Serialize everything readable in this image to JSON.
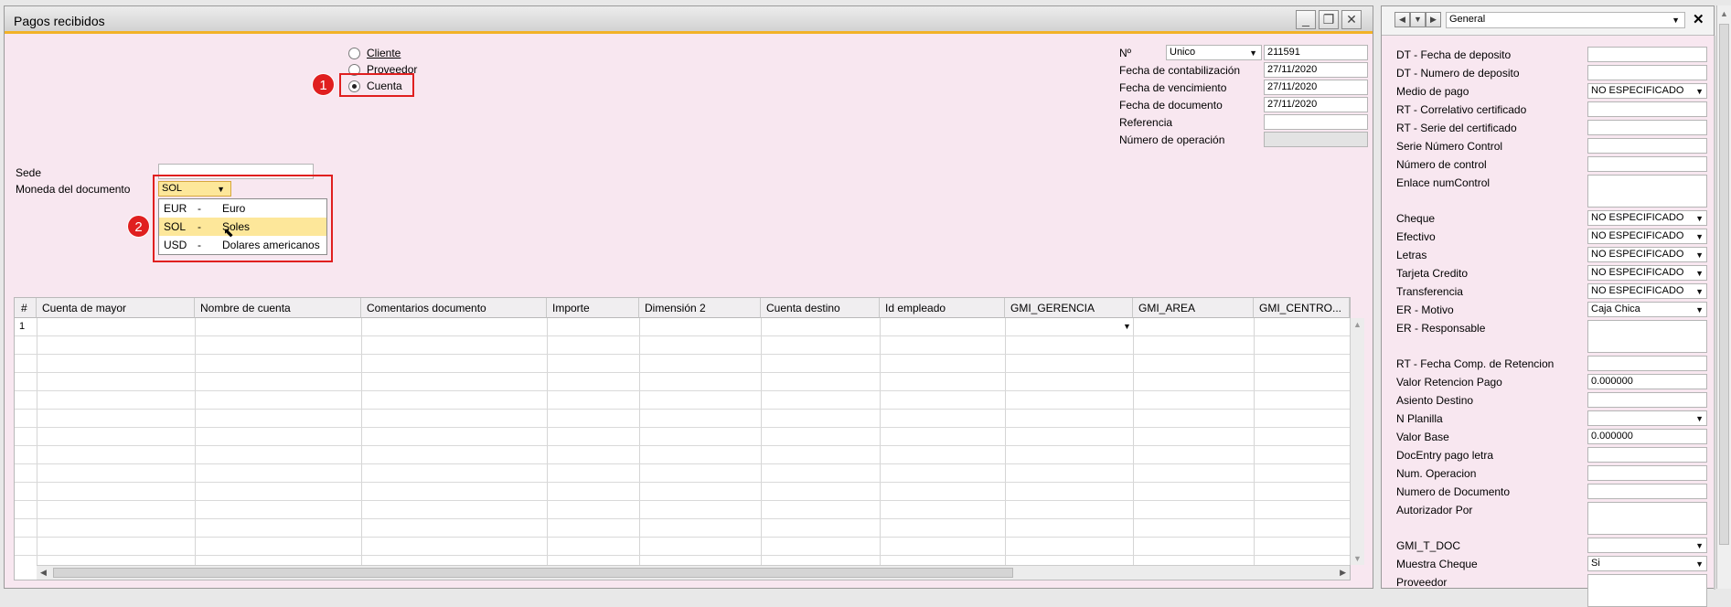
{
  "window": {
    "title": "Pagos recibidos",
    "minimize": "_",
    "restore": "❐",
    "close": "✕"
  },
  "radio": {
    "cliente": "Cliente",
    "proveedor": "Proveedor",
    "cuenta": "Cuenta",
    "selected": "Cuenta"
  },
  "markers": {
    "one": "1",
    "two": "2"
  },
  "header_fields": {
    "no_label": "Nº",
    "no_series": "Unico",
    "no_value": "211591",
    "fecha_contab_label": "Fecha de contabilización",
    "fecha_contab": "27/11/2020",
    "fecha_venc_label": "Fecha de vencimiento",
    "fecha_venc": "27/11/2020",
    "fecha_doc_label": "Fecha de documento",
    "fecha_doc": "27/11/2020",
    "referencia_label": "Referencia",
    "referencia": "",
    "num_operacion_label": "Número de operación",
    "num_operacion": ""
  },
  "sede": {
    "label": "Sede",
    "value": ""
  },
  "moneda": {
    "label": "Moneda del documento",
    "value": "SOL",
    "options": [
      {
        "code": "EUR",
        "sep": "-",
        "name": "Euro"
      },
      {
        "code": "SOL",
        "sep": "-",
        "name": "Soles"
      },
      {
        "code": "USD",
        "sep": "-",
        "name": "Dolares americanos"
      }
    ],
    "highlighted": "SOL"
  },
  "grid": {
    "columns": [
      "#",
      "Cuenta de mayor",
      "Nombre de cuenta",
      "Comentarios documento",
      "Importe",
      "Dimensión 2",
      "Cuenta destino",
      "Id empleado",
      "GMI_GERENCIA",
      "GMI_AREA",
      "GMI_CENTRO..."
    ],
    "first_row_num": "1"
  },
  "side_panel": {
    "nav_prev": "◀",
    "nav_down": "▼",
    "nav_next": "▶",
    "category": "General",
    "close": "✕",
    "fields": [
      {
        "label": "DT - Fecha de deposito",
        "value": ""
      },
      {
        "label": "DT - Numero de deposito",
        "value": ""
      },
      {
        "label": "Medio de pago",
        "value": "NO ESPECIFICADO",
        "dropdown": true
      },
      {
        "label": "RT - Correlativo certificado",
        "value": ""
      },
      {
        "label": "RT - Serie del certificado",
        "value": ""
      },
      {
        "label": "Serie Número Control",
        "value": ""
      },
      {
        "label": "Número de control",
        "value": ""
      },
      {
        "label": "Enlace numControl",
        "value": "",
        "tall": true
      },
      {
        "label": "Cheque",
        "value": "NO ESPECIFICADO",
        "dropdown": true
      },
      {
        "label": "Efectivo",
        "value": "NO ESPECIFICADO",
        "dropdown": true
      },
      {
        "label": "Letras",
        "value": "NO ESPECIFICADO",
        "dropdown": true
      },
      {
        "label": "Tarjeta Credito",
        "value": "NO ESPECIFICADO",
        "dropdown": true
      },
      {
        "label": "Transferencia",
        "value": "NO ESPECIFICADO",
        "dropdown": true
      },
      {
        "label": "ER - Motivo",
        "value": "Caja Chica",
        "dropdown": true
      },
      {
        "label": "ER - Responsable",
        "value": "",
        "tall": true
      },
      {
        "label": "RT - Fecha Comp. de Retencion",
        "value": ""
      },
      {
        "label": "Valor Retencion Pago",
        "value": "0.000000"
      },
      {
        "label": "Asiento Destino",
        "value": ""
      },
      {
        "label": "N Planilla",
        "value": "",
        "dropdown": true
      },
      {
        "label": "Valor Base",
        "value": "0.000000"
      },
      {
        "label": "DocEntry pago letra",
        "value": ""
      },
      {
        "label": "Num. Operacion",
        "value": ""
      },
      {
        "label": "Numero de Documento",
        "value": ""
      },
      {
        "label": "Autorizador Por",
        "value": "",
        "tall": true
      },
      {
        "label": "GMI_T_DOC",
        "value": "",
        "dropdown": true
      },
      {
        "label": "Muestra Cheque",
        "value": "Si",
        "dropdown": true
      },
      {
        "label": "Proveedor",
        "value": "",
        "tall": true
      }
    ]
  },
  "colors": {
    "form_bg": "#f8e7f0",
    "accent_line": "#f2b227",
    "marker_red": "#e01f1f",
    "highlight": "#fde79a"
  }
}
